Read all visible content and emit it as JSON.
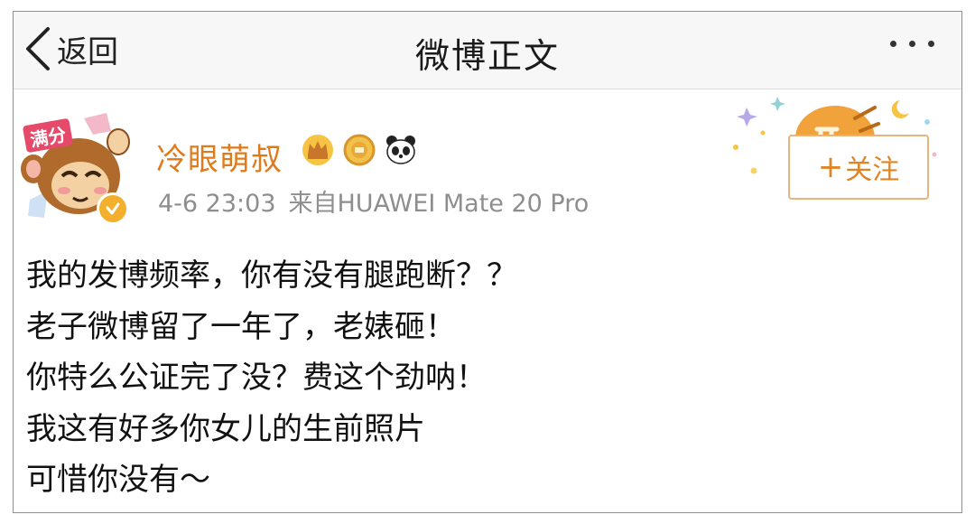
{
  "nav": {
    "back_label": "返回",
    "title": "微博正文",
    "more_icon": "more-dots-icon"
  },
  "post": {
    "username": "冷眼萌叔",
    "time": "4-6 23:03",
    "source": "来自HUAWEI Mate 20 Pro",
    "badges": [
      "crown-icon",
      "vip-medal-icon",
      "panda-icon"
    ],
    "verified_icon": "verified-check-icon",
    "avatar_label": "满分",
    "follow_label": "关注",
    "follow_icon": "plus-icon",
    "lines": [
      "我的发博频率，你有没有腿跑断？？",
      "老子微博留了一年了，老婊砸！",
      "你特么公证完了没？费这个劲呐！",
      "我这有好多你女儿的生前照片",
      "可惜你没有～"
    ]
  },
  "colors": {
    "username": "#e07a1a",
    "follow_border": "#e9b37a",
    "meta_text": "#8e8e8e",
    "nav_bg": "#f7f7f7"
  }
}
